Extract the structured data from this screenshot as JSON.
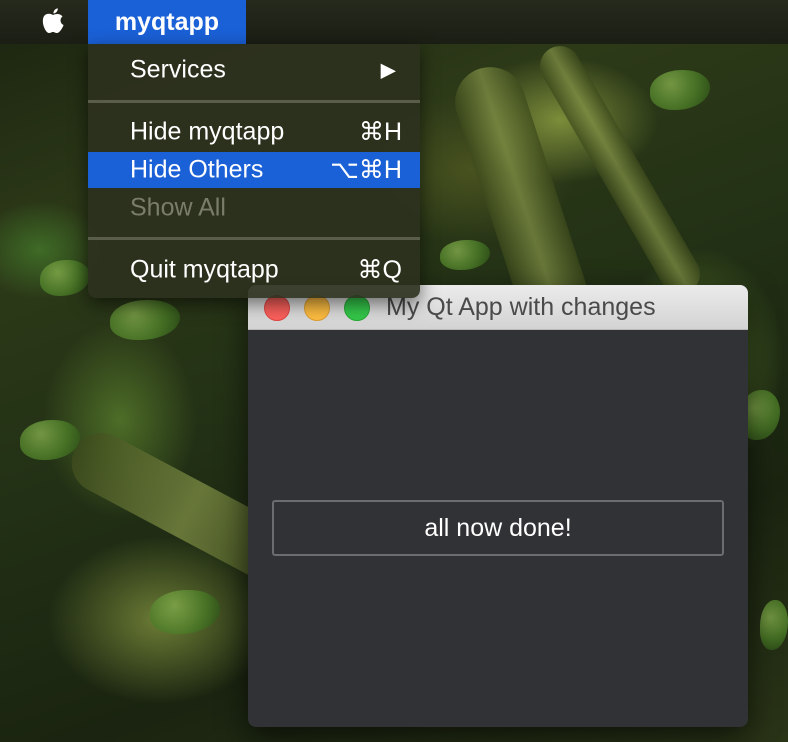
{
  "menubar": {
    "apple_icon": "apple-logo-icon",
    "app_menu_title": "myqtapp"
  },
  "app_menu": {
    "items": [
      {
        "label": "Services",
        "shortcut": "▶",
        "state": "normal"
      },
      {
        "label": "Hide myqtapp",
        "shortcut": "⌘H",
        "state": "normal"
      },
      {
        "label": "Hide Others",
        "shortcut": "⌥⌘H",
        "state": "highlighted"
      },
      {
        "label": "Show All",
        "shortcut": "",
        "state": "disabled"
      },
      {
        "label": "Quit myqtapp",
        "shortcut": "⌘Q",
        "state": "normal"
      }
    ]
  },
  "window": {
    "title": "My Qt App with changes",
    "button_label": "all now done!"
  },
  "colors": {
    "accent": "#1a60d6",
    "window_background": "#303236",
    "close": "#fc605c",
    "minimize": "#fdbc40",
    "zoom": "#34c84a"
  }
}
